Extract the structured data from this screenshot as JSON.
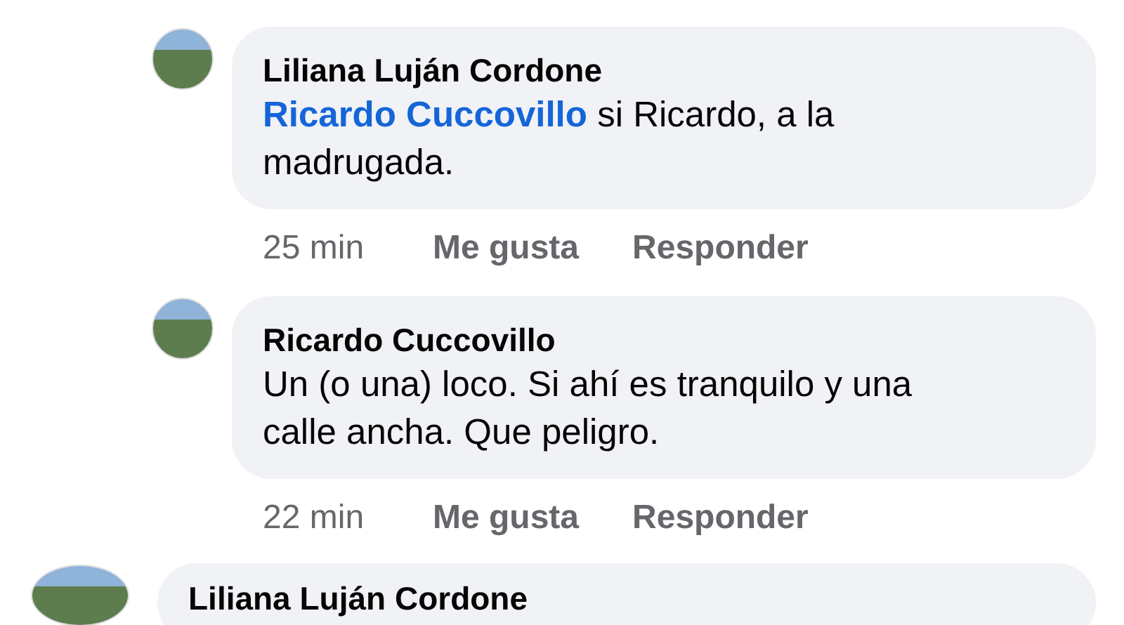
{
  "comments": [
    {
      "kind": "reply",
      "author": "Liliana Luján Cordone",
      "mention": "Ricardo Cuccovillo",
      "text": "si Ricardo, a la madrugada.",
      "time": "25 min",
      "like": "Me gusta",
      "reply": "Responder"
    },
    {
      "kind": "reply",
      "author": "Ricardo Cuccovillo",
      "text": "Un (o una) loco. Si ahí es tranquilo y una calle ancha. Que peligro.",
      "time": "22 min",
      "like": "Me gusta",
      "reply": "Responder"
    },
    {
      "kind": "comment",
      "author": "Liliana Luján Cordone"
    }
  ]
}
